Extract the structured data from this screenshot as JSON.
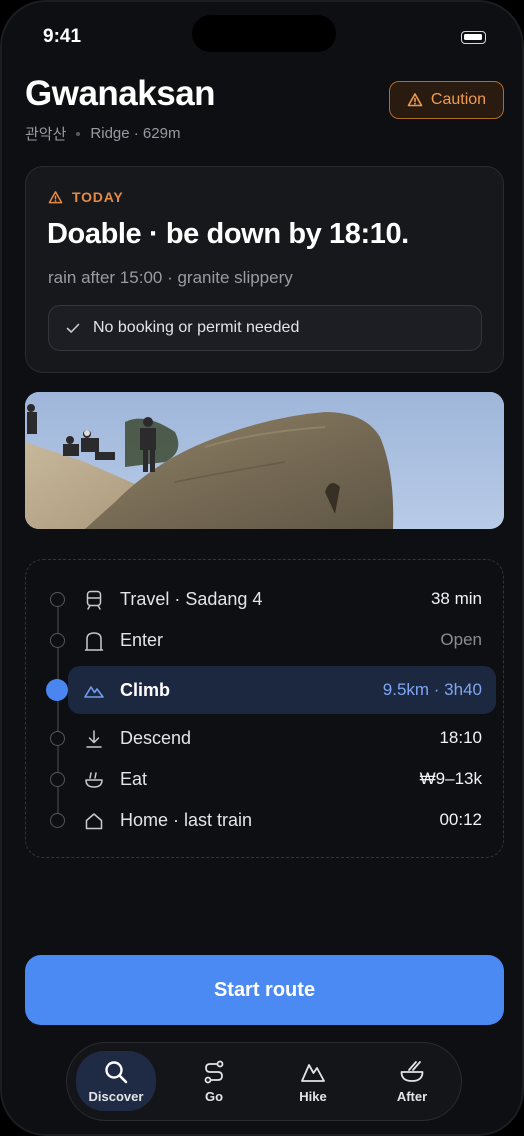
{
  "status_bar": {
    "time": "9:41"
  },
  "header": {
    "title": "Gwanaksan",
    "korean_name": "관악산",
    "meta": "Ridge · 629m",
    "badge": {
      "label": "Caution",
      "icon": "warning-icon",
      "color": "#f09a52"
    }
  },
  "today_card": {
    "label": "TODAY",
    "headline": "Doable · be down by 18:10.",
    "conditions": "rain after 15:00 · granite slippery",
    "booking": "No booking or permit needed"
  },
  "route": {
    "steps": [
      {
        "icon": "train-icon",
        "label": "Travel · Sadang 4",
        "value": "38 min",
        "active": false
      },
      {
        "icon": "gate-icon",
        "label": "Enter",
        "value": "Open",
        "active": false
      },
      {
        "icon": "mountain-icon",
        "label": "Climb",
        "value": "9.5km · 3h40",
        "active": true
      },
      {
        "icon": "descend-icon",
        "label": "Descend",
        "value": "18:10",
        "active": false
      },
      {
        "icon": "bowl-icon",
        "label": "Eat",
        "value": "₩9–13k",
        "active": false
      },
      {
        "icon": "home-icon",
        "label": "Home · last train",
        "value": "00:12",
        "active": false
      }
    ]
  },
  "cta": {
    "label": "Start route",
    "color": "#4b8af2"
  },
  "tabs": [
    {
      "label": "Discover",
      "icon": "search-icon",
      "active": true
    },
    {
      "label": "Go",
      "icon": "route-icon",
      "active": false
    },
    {
      "label": "Hike",
      "icon": "mountain-icon",
      "active": false
    },
    {
      "label": "After",
      "icon": "bowl-icon",
      "active": false
    }
  ]
}
